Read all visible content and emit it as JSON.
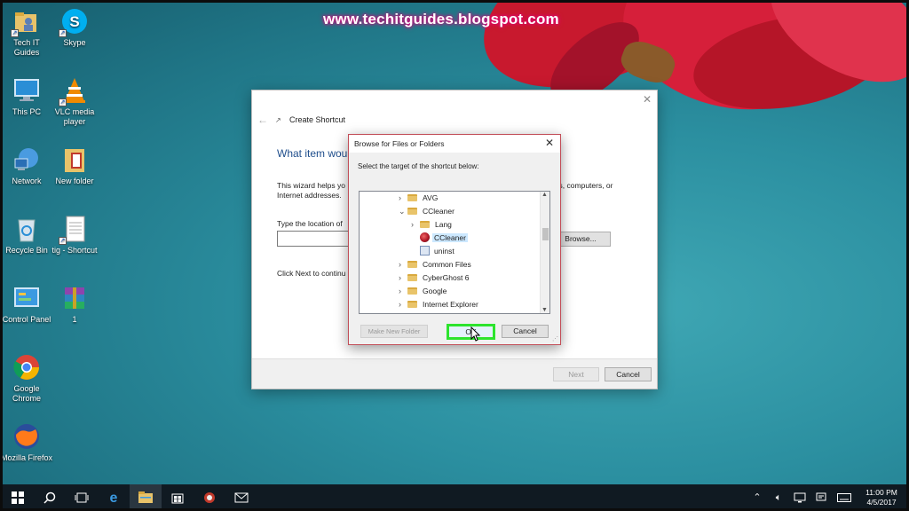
{
  "watermark": "www.techitguides.blogspot.com",
  "desktop_icons": [
    {
      "label": "Tech IT Guides",
      "icon": "folder-person-icon"
    },
    {
      "label": "Skype",
      "icon": "skype-icon"
    },
    {
      "label": "This PC",
      "icon": "computer-icon"
    },
    {
      "label": "VLC media player",
      "icon": "vlc-icon"
    },
    {
      "label": "Network",
      "icon": "network-icon"
    },
    {
      "label": "New folder",
      "icon": "folder-icon"
    },
    {
      "label": "Recycle Bin",
      "icon": "recycle-bin-icon"
    },
    {
      "label": "tig - Shortcut",
      "icon": "document-icon"
    },
    {
      "label": "Control Panel",
      "icon": "control-panel-icon"
    },
    {
      "label": "1",
      "icon": "winrar-archive-icon"
    },
    {
      "label": "Google Chrome",
      "icon": "chrome-icon"
    },
    {
      "label": "Mozilla Firefox",
      "icon": "firefox-icon"
    }
  ],
  "wizard": {
    "title": "Create Shortcut",
    "heading": "What item wou",
    "description": "This wizard helps yo",
    "description_right": "ers, computers, or",
    "description_line2": "Internet addresses.",
    "location_label": "Type the location of",
    "location_value": "",
    "browse_label": "Browse...",
    "click_next": "Click Next to continu",
    "next_label": "Next",
    "cancel_label": "Cancel"
  },
  "browse_dialog": {
    "title": "Browse for Files or Folders",
    "instruction": "Select the target of the shortcut below:",
    "tree": [
      {
        "label": "AVG",
        "type": "folder",
        "expander": "collapsed",
        "depth": 0
      },
      {
        "label": "CCleaner",
        "type": "folder",
        "expander": "expanded",
        "depth": 0
      },
      {
        "label": "Lang",
        "type": "folder",
        "expander": "collapsed",
        "depth": 1
      },
      {
        "label": "CCleaner",
        "type": "app",
        "expander": "none",
        "depth": 1,
        "selected": true
      },
      {
        "label": "uninst",
        "type": "uninstaller",
        "expander": "none",
        "depth": 1
      },
      {
        "label": "Common Files",
        "type": "folder",
        "expander": "collapsed",
        "depth": 0
      },
      {
        "label": "CyberGhost 6",
        "type": "folder",
        "expander": "collapsed",
        "depth": 0
      },
      {
        "label": "Google",
        "type": "folder",
        "expander": "collapsed",
        "depth": 0
      },
      {
        "label": "Internet Explorer",
        "type": "folder",
        "expander": "collapsed",
        "depth": 0
      }
    ],
    "new_folder_label": "Make New Folder",
    "ok_label": "OK",
    "cancel_label": "Cancel"
  },
  "taskbar": {
    "items": [
      "start-icon",
      "search-icon",
      "task-view-icon",
      "edge-icon",
      "file-explorer-icon",
      "store-icon",
      "ccleaner-taskbar-icon",
      "mail-icon"
    ],
    "clock_time": "11:00 PM",
    "clock_date": "4/5/2017"
  },
  "colors": {
    "highlight_box": "#2de42d",
    "selection": "#cce8ff",
    "watermark_glow": "#e0007a"
  }
}
